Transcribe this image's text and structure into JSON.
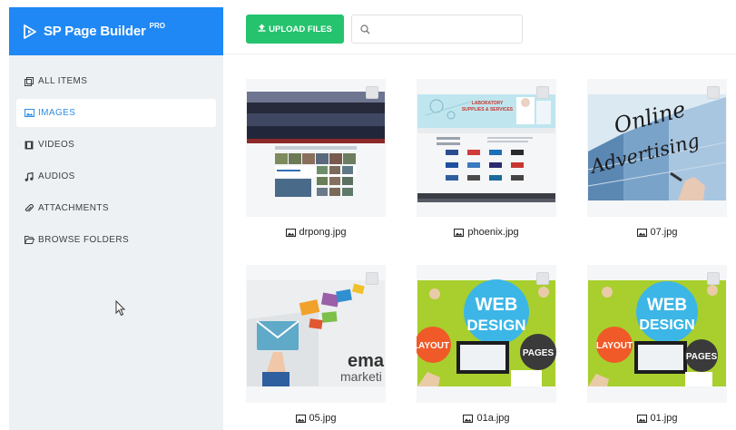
{
  "brand": {
    "name": "SP Page Builder",
    "badge": "PRO",
    "color": "#1f88f4"
  },
  "sidebar": {
    "items": [
      {
        "label": "ALL ITEMS",
        "icon": "grid-icon",
        "active": false
      },
      {
        "label": "IMAGES",
        "icon": "image-icon",
        "active": true
      },
      {
        "label": "VIDEOS",
        "icon": "film-icon",
        "active": false
      },
      {
        "label": "AUDIOS",
        "icon": "music-icon",
        "active": false
      },
      {
        "label": "ATTACHMENTS",
        "icon": "paperclip-icon",
        "active": false
      },
      {
        "label": "BROWSE FOLDERS",
        "icon": "folder-open-icon",
        "active": false
      }
    ]
  },
  "toolbar": {
    "upload_label": "UPLOAD FILES",
    "upload_color": "#25c36e",
    "search": {
      "value": "",
      "placeholder": ""
    }
  },
  "media": [
    {
      "name": "drpong.jpg",
      "art": "group-photo"
    },
    {
      "name": "phoenix.jpg",
      "art": "supplies-site"
    },
    {
      "name": "07.jpg",
      "art": "online-advertising"
    },
    {
      "name": "05.jpg",
      "art": "email-marketing"
    },
    {
      "name": "01a.jpg",
      "art": "web-design"
    },
    {
      "name": "01.jpg",
      "art": "web-design"
    }
  ],
  "art_text": {
    "online_advertising": [
      "Online",
      "Advertising"
    ],
    "email_marketing": [
      "ema",
      "marketi"
    ],
    "web_design": [
      "WEB",
      "DESIGN",
      "LAYOUT",
      "PAGES"
    ],
    "phoenix_banner": [
      "LABORATORY",
      "SUPPLIES & SERVICES"
    ]
  }
}
